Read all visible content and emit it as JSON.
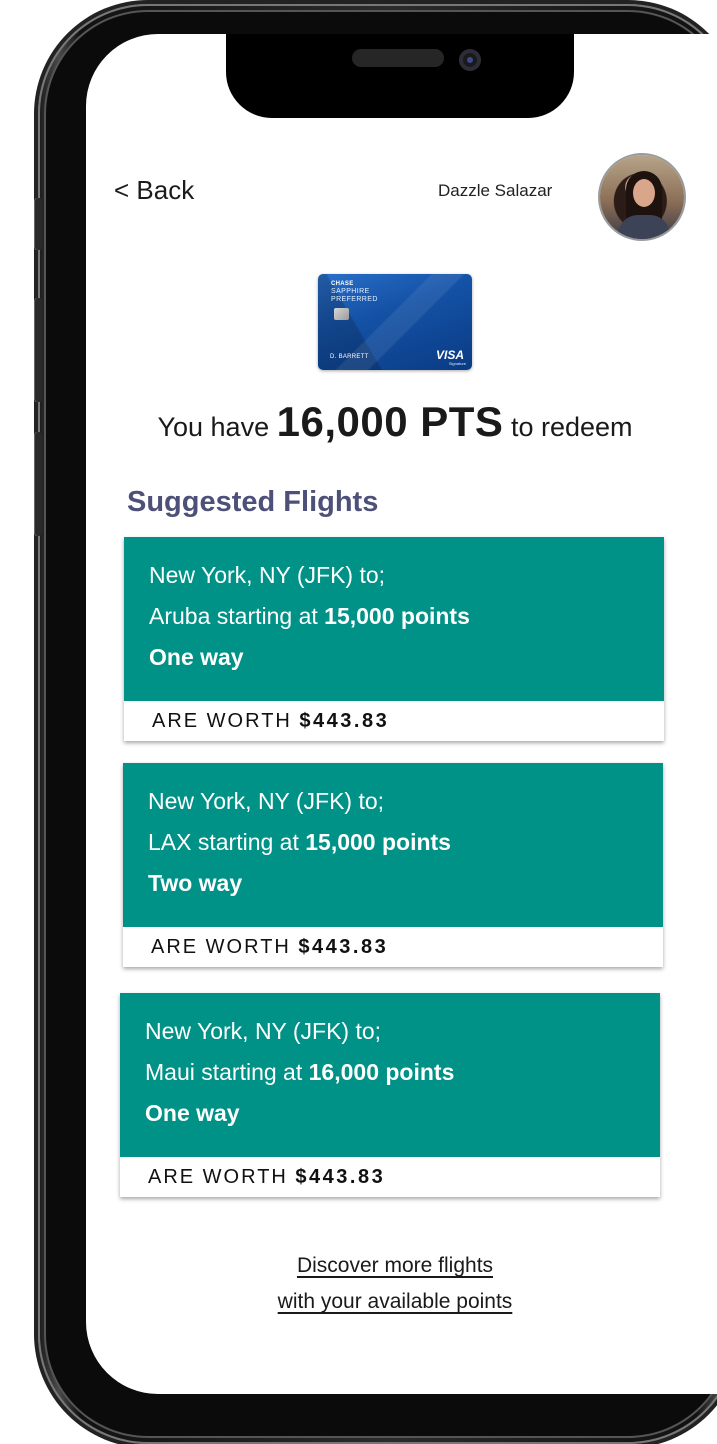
{
  "header": {
    "back_label": "< Back",
    "user_name": "Dazzle Salazar"
  },
  "card": {
    "issuer": "CHASE",
    "product_line1": "SAPPHIRE",
    "product_line2": "PREFERRED",
    "holder": "D. BARRETT",
    "network": "VISA",
    "network_sub": "Signature"
  },
  "points": {
    "prefix": "You have",
    "amount": "16,000 PTS",
    "suffix": "to redeem"
  },
  "section_title": "Suggested Flights",
  "flights": [
    {
      "origin": "New York, NY (JFK) to;",
      "destination_prefix": "Aruba starting at",
      "points": "15,000 points",
      "trip_type": "One way",
      "worth_label": "ARE WORTH",
      "worth_value": "$443.83"
    },
    {
      "origin": "New York, NY (JFK) to;",
      "destination_prefix": "LAX starting at",
      "points": "15,000 points",
      "trip_type": "Two way",
      "worth_label": "ARE WORTH",
      "worth_value": "$443.83"
    },
    {
      "origin": "New York, NY (JFK) to;",
      "destination_prefix": "Maui starting at",
      "points": "16,000 points",
      "trip_type": "One way",
      "worth_label": "ARE WORTH",
      "worth_value": "$443.83"
    }
  ],
  "discover": {
    "line1": "Discover more flights",
    "line2": "with your available points"
  },
  "colors": {
    "accent_teal": "#009287",
    "section_title": "#4d5078",
    "card_blue": "#1452a6"
  }
}
